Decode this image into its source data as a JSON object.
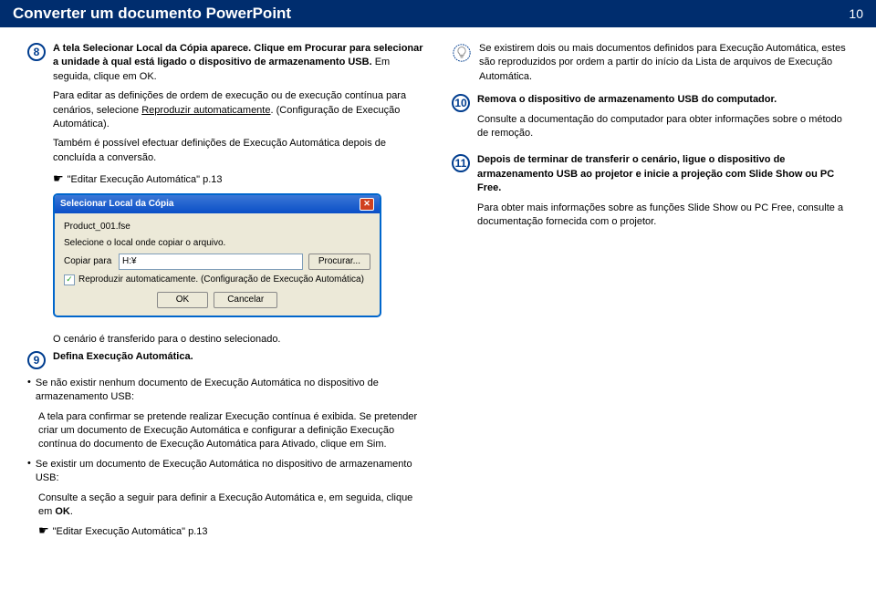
{
  "header": {
    "title": "Converter um documento PowerPoint",
    "page": "10"
  },
  "step8": {
    "num": "8",
    "p1a": "A tela Selecionar Local da Cópia aparece. Clique em Procurar para selecionar a unidade à qual está ligado o dispositivo de armazenamento USB.",
    "p1b": " Em seguida, clique em OK.",
    "p2a": "Para editar as definições de ordem de execução ou de execução contínua para cenários, selecione ",
    "p2b": "Reproduzir automaticamente",
    "p2c": ". (Configuração de Execução Automática).",
    "p3": "Também é possível efectuar definições de Execução Automática depois de concluída a conversão.",
    "p4": "\"Editar Execução Automática\" p.13"
  },
  "dialog": {
    "title": "Selecionar Local da Cópia",
    "filename": "Product_001.fse",
    "instruction": "Selecione o local onde copiar o arquivo.",
    "copyTo": "Copiar para",
    "value": "H:¥",
    "browse": "Procurar...",
    "checkbox": "Reproduzir automaticamente. (Configuração de Execução Automática)",
    "ok": "OK",
    "cancel": "Cancelar"
  },
  "transfer": "O cenário é transferido para o destino selecionado.",
  "step9": {
    "num": "9",
    "title": "Defina Execução Automática.",
    "b1": "Se não existir nenhum documento de Execução Automática no dispositivo de armazenamento USB:",
    "b1d": "A tela para confirmar se pretende realizar Execução contínua é exibida. Se pretender criar um documento de Execução Automática e configurar a definição Execução contínua do documento de Execução Automática para Ativado, clique em Sim.",
    "b2": "Se existir um documento de Execução Automática no dispositivo de armazenamento USB:",
    "b2a": "Consulte a seção a seguir para definir a Execução Automática e, em seguida, clique em ",
    "b2b": "OK",
    "b2c": ".",
    "ref": "\"Editar Execução Automática\" p.13"
  },
  "tip": "Se existirem dois ou mais documentos definidos para Execução Automática, estes são reproduzidos por ordem a partir do início da Lista de arquivos de Execução Automática.",
  "step10": {
    "num": "10",
    "p1": "Remova o dispositivo de armazenamento USB do computador.",
    "p2": "Consulte a documentação do computador para obter informações sobre o método de remoção."
  },
  "step11": {
    "num": "11",
    "p1": "Depois de terminar de transferir o cenário, ligue o dispositivo de armazenamento USB ao projetor e inicie a projeção com Slide Show ou PC Free.",
    "p2": "Para obter mais informações sobre as funções Slide Show ou PC Free, consulte a documentação fornecida com o projetor."
  }
}
